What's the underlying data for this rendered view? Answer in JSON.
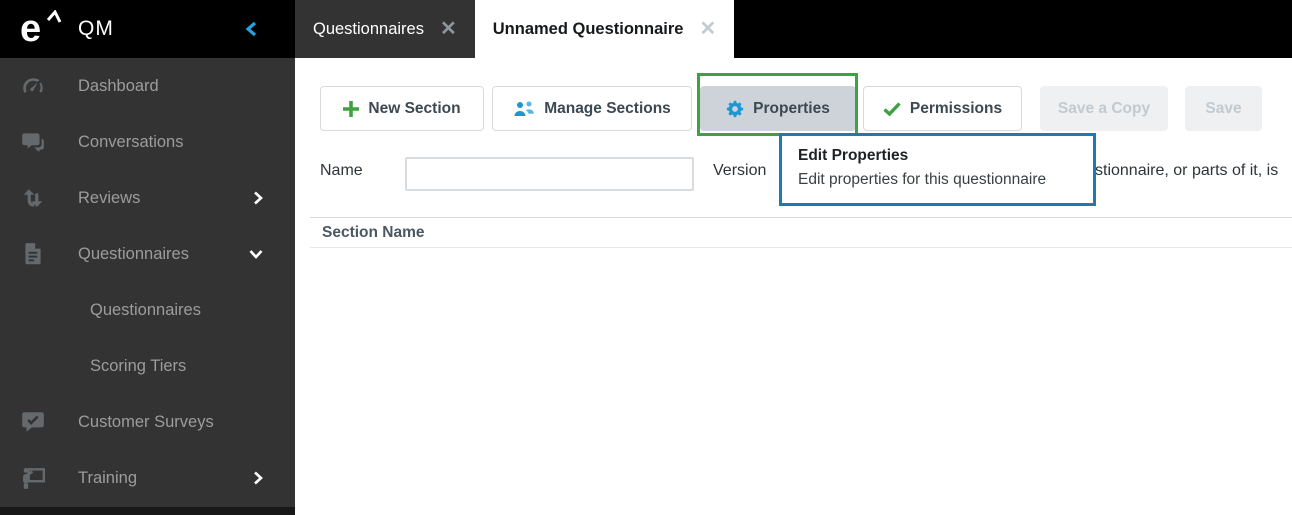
{
  "app": {
    "logo_letter": "e",
    "title": "QM"
  },
  "sidebar": {
    "items": [
      {
        "label": "Dashboard",
        "icon": "gauge-icon"
      },
      {
        "label": "Conversations",
        "icon": "chat-bubbles-icon"
      },
      {
        "label": "Reviews",
        "icon": "arrows-up-down-icon",
        "chevron": "right"
      },
      {
        "label": "Questionnaires",
        "icon": "document-icon",
        "chevron": "down",
        "expanded": true
      },
      {
        "label": "Questionnaires",
        "sub": true
      },
      {
        "label": "Scoring Tiers",
        "sub": true
      },
      {
        "label": "Customer Surveys",
        "icon": "survey-check-bubble-icon"
      },
      {
        "label": "Training",
        "icon": "trainer-board-icon",
        "chevron": "right"
      }
    ]
  },
  "tabs": [
    {
      "label": "Questionnaires",
      "active": false
    },
    {
      "label": "Unnamed Questionnaire",
      "active": true
    }
  ],
  "toolbar": {
    "new_section_label": "New Section",
    "manage_sections_label": "Manage Sections",
    "properties_label": "Properties",
    "permissions_label": "Permissions",
    "save_a_copy_label": "Save a Copy",
    "save_label": "Save",
    "save_a_copy_disabled": true,
    "save_disabled": true
  },
  "form": {
    "name_label": "Name",
    "name_value": "",
    "version_label": "Version",
    "clipped_text_fragment": "stionnaire, or parts of it, is"
  },
  "tooltip": {
    "title": "Edit Properties",
    "description": "Edit properties for this questionnaire"
  },
  "table": {
    "section_header": "Section Name"
  },
  "colors": {
    "sidebar_bg": "#333333",
    "sidebar_header_bg": "#000000",
    "sidebar_text": "#9c9c9c",
    "collapse_chevron_blue": "#25a3de",
    "icon_blue": "#1e96d2",
    "icon_green": "#3fa142",
    "annotation_green_box": "#3fa044",
    "annotation_blue_box": "#1f79b7",
    "properties_btn_bg": "#cdd3d9",
    "disabled_btn_bg": "#eef0f1"
  }
}
